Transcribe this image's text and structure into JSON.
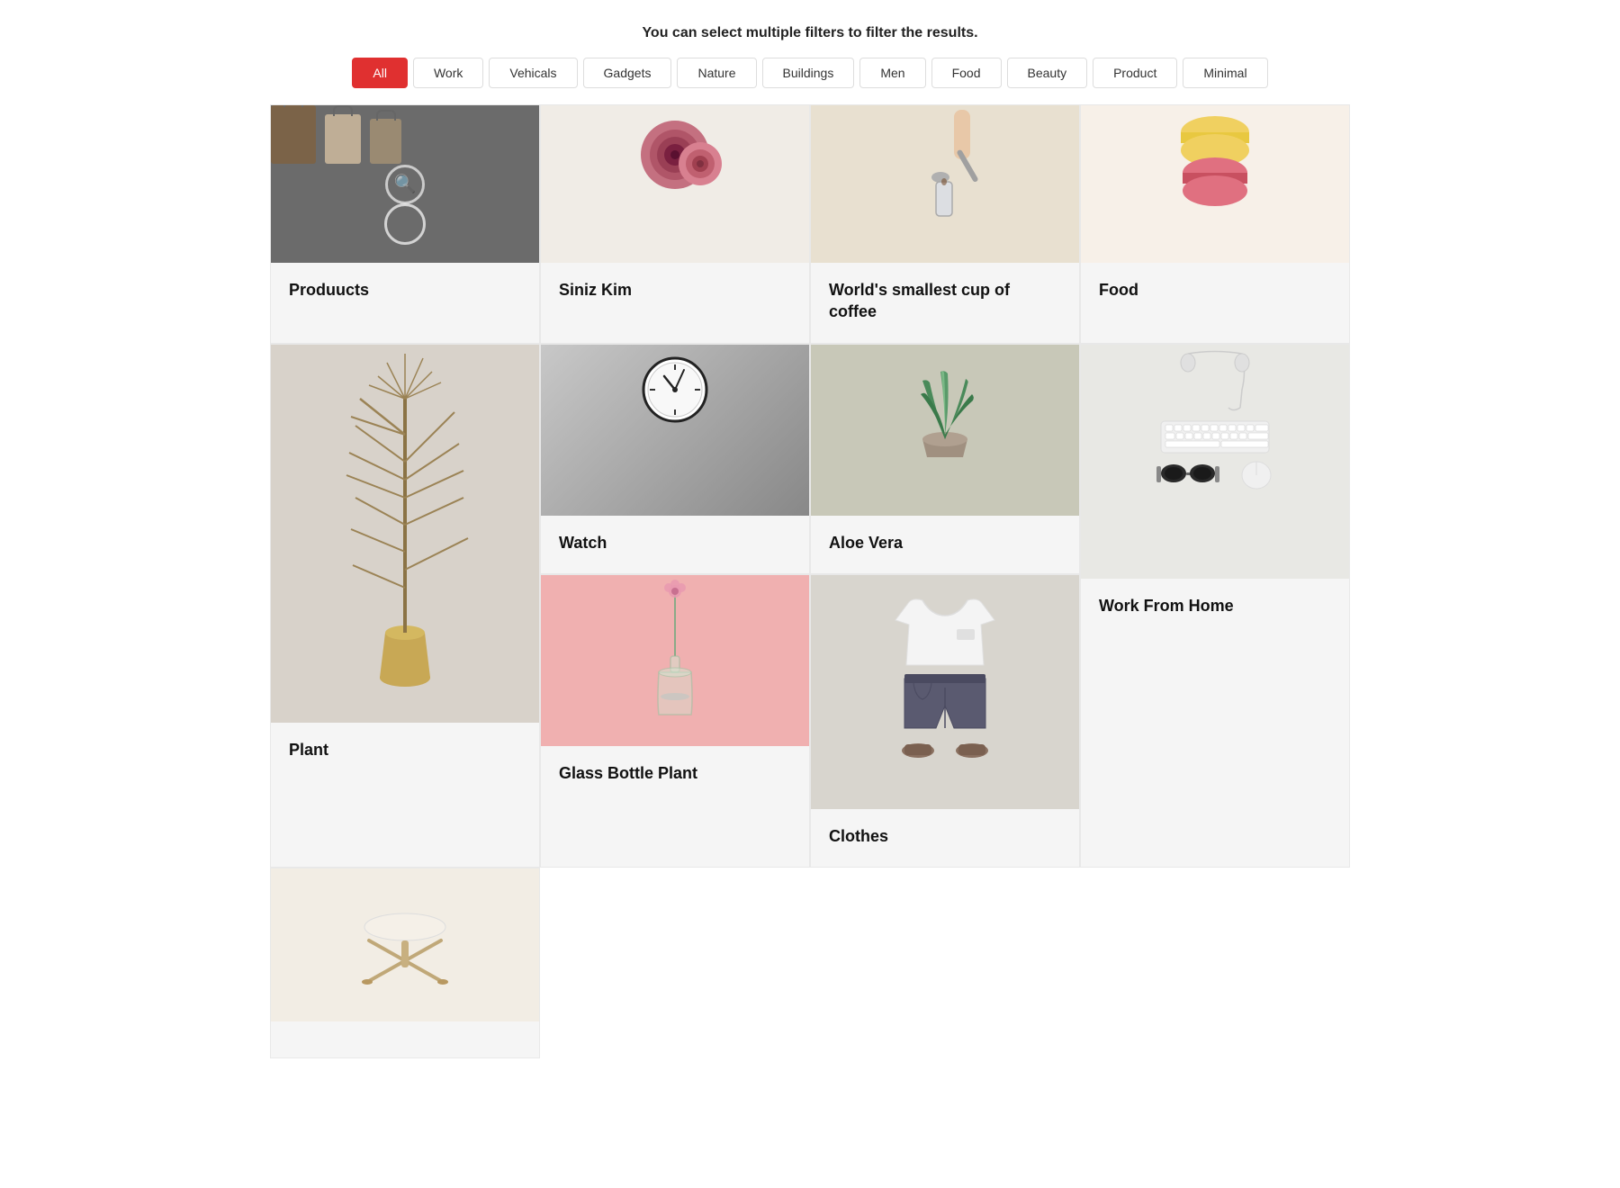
{
  "header": {
    "instruction": "You can select multiple filters to filter the results."
  },
  "filters": {
    "buttons": [
      {
        "id": "all",
        "label": "All",
        "active": true
      },
      {
        "id": "work",
        "label": "Work",
        "active": false
      },
      {
        "id": "vehicals",
        "label": "Vehicals",
        "active": false
      },
      {
        "id": "gadgets",
        "label": "Gadgets",
        "active": false
      },
      {
        "id": "nature",
        "label": "Nature",
        "active": false
      },
      {
        "id": "buildings",
        "label": "Buildings",
        "active": false
      },
      {
        "id": "men",
        "label": "Men",
        "active": false
      },
      {
        "id": "food",
        "label": "Food",
        "active": false
      },
      {
        "id": "beauty",
        "label": "Beauty",
        "active": false
      },
      {
        "id": "product",
        "label": "Product",
        "active": false
      },
      {
        "id": "minimal",
        "label": "Minimal",
        "active": false
      }
    ]
  },
  "grid": {
    "items": [
      {
        "id": "products",
        "title": "Produucts",
        "bg": "products"
      },
      {
        "id": "siniz",
        "title": "Siniz Kim",
        "bg": "siniz"
      },
      {
        "id": "coffee",
        "title": "World's smallest cup of coffee",
        "bg": "coffee"
      },
      {
        "id": "food",
        "title": "Food",
        "bg": "food"
      },
      {
        "id": "plant",
        "title": "Plant",
        "bg": "plant"
      },
      {
        "id": "watch",
        "title": "Watch",
        "bg": "watch"
      },
      {
        "id": "aloevera",
        "title": "Aloe Vera",
        "bg": "aloevera"
      },
      {
        "id": "wfh",
        "title": "Work From Home",
        "bg": "wfh"
      },
      {
        "id": "glass-bottle",
        "title": "Glass Bottle Plant",
        "bg": "glass-bottle"
      },
      {
        "id": "clothes",
        "title": "Clothes",
        "bg": "clothes"
      },
      {
        "id": "chair",
        "title": "",
        "bg": "chair"
      }
    ]
  }
}
